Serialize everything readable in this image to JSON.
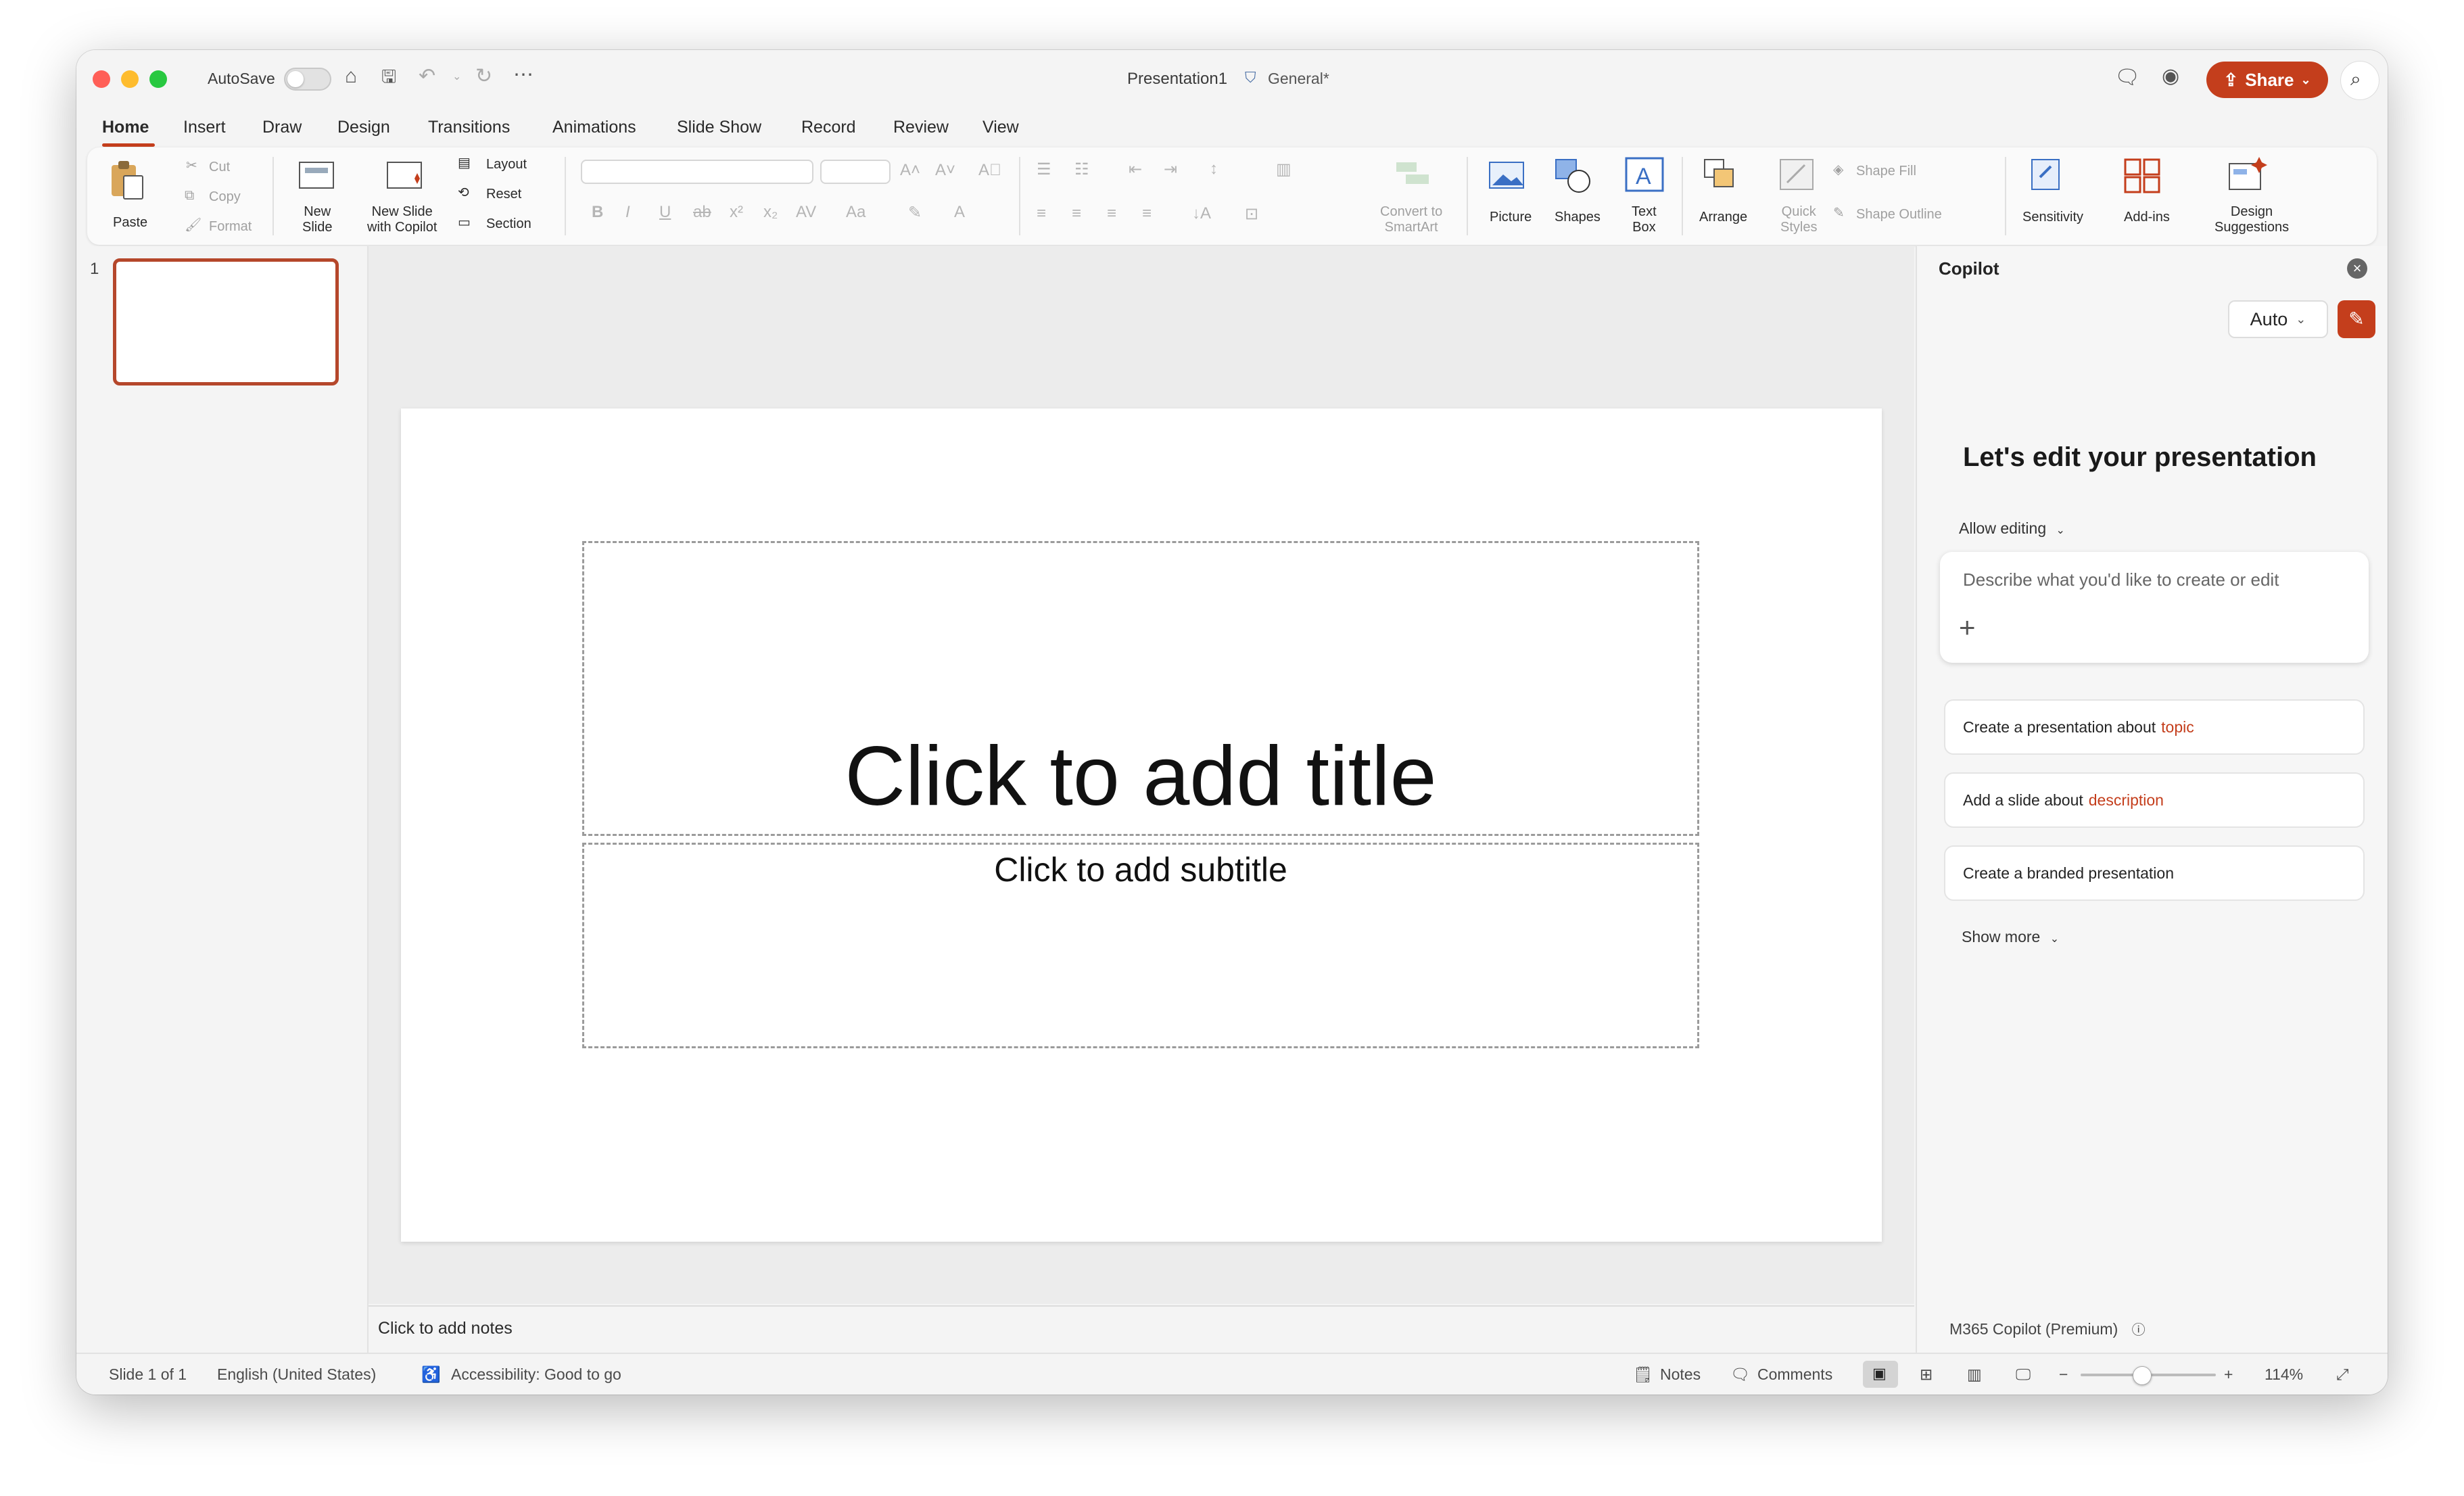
{
  "titlebar": {
    "autosave_label": "AutoSave",
    "doc_title": "Presentation1",
    "sensitivity": "General*",
    "share_label": "Share"
  },
  "tabs": [
    "Home",
    "Insert",
    "Draw",
    "Design",
    "Transitions",
    "Animations",
    "Slide Show",
    "Record",
    "Review",
    "View"
  ],
  "ribbon": {
    "paste": "Paste",
    "cut": "Cut",
    "copy": "Copy",
    "format": "Format",
    "new_slide_l1": "New",
    "new_slide_l2": "Slide",
    "new_slide_copilot_l1": "New Slide",
    "new_slide_copilot_l2": "with Copilot",
    "layout": "Layout",
    "reset": "Reset",
    "section": "Section",
    "convert_l1": "Convert to",
    "convert_l2": "SmartArt",
    "picture": "Picture",
    "shapes": "Shapes",
    "textbox_l1": "Text",
    "textbox_l2": "Box",
    "arrange": "Arrange",
    "quick_styles_l1": "Quick",
    "quick_styles_l2": "Styles",
    "shape_fill": "Shape Fill",
    "shape_outline": "Shape Outline",
    "sensitivity": "Sensitivity",
    "addins": "Add-ins",
    "design_sugg_l1": "Design",
    "design_sugg_l2": "Suggestions"
  },
  "thumbs": {
    "slide_number": "1"
  },
  "slide": {
    "title_placeholder": "Click to add title",
    "subtitle_placeholder": "Click to add subtitle"
  },
  "notes": {
    "placeholder": "Click to add notes"
  },
  "copilot": {
    "header": "Copilot",
    "mode": "Auto",
    "heading": "Let's edit your presentation",
    "allow_editing": "Allow editing",
    "prompt_placeholder": "Describe what you'd like to create or edit",
    "suggestions": [
      {
        "text": "Create a presentation about",
        "accent": "topic"
      },
      {
        "text": "Add a slide about",
        "accent": "description"
      },
      {
        "text": "Create a branded presentation",
        "accent": ""
      }
    ],
    "show_more": "Show more",
    "license": "M365 Copilot (Premium)"
  },
  "status": {
    "slide_of": "Slide 1 of 1",
    "language": "English (United States)",
    "accessibility": "Accessibility: Good to go",
    "notes": "Notes",
    "comments": "Comments",
    "zoom": "114%",
    "zoom_fraction": 0.45
  },
  "colors": {
    "accent": "#c43e1c",
    "close": "#ff5f57",
    "minimize": "#febc2e",
    "zoom": "#28c840"
  }
}
